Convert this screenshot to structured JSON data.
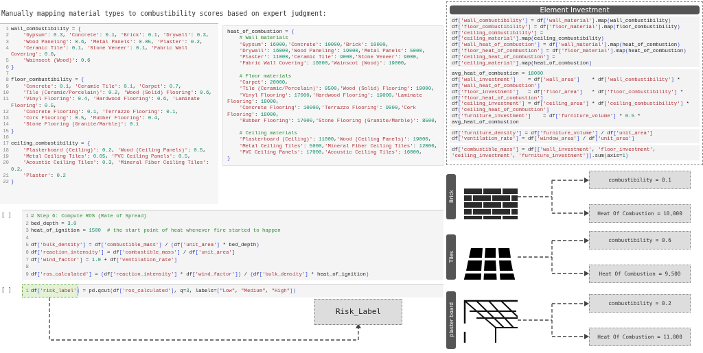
{
  "caption": "Manually mapping material types to combustibility scores based on expert judgment:",
  "numbered_code": {
    "lines": [
      {
        "number": "1",
        "text": "wall_combustibility = {"
      },
      {
        "number": "2",
        "text": "    'Gypsum': 0.3, 'Concrete': 0.1, 'Brick': 0.1, 'Drywall': 0.3,"
      },
      {
        "number": "3",
        "text": "    'Wood Paneling': 0.6, 'Metal Panels': 0.05, 'Plaster': 0.2,"
      },
      {
        "number": "4",
        "text": "    'Ceramic Tile': 0.1, 'Stone Veneer': 0.1, 'Fabric Wall Covering': 0.6,"
      },
      {
        "number": "5",
        "text": "    'Wainscot (Wood)': 0.6"
      },
      {
        "number": "6",
        "text": "}"
      },
      {
        "number": "7"
      },
      {
        "number": "8",
        "text": "floor_combustibility = {"
      },
      {
        "number": "9",
        "text": "    'Concrete': 0.1, 'Ceramic Tile': 0.1, 'Carpet': 0.7,"
      },
      {
        "number": "10",
        "text": "    'Tile (Ceramic/Porcelain)': 0.2, 'Wood (Solid) Flooring': 0.6,"
      },
      {
        "number": "11",
        "text": "    'Vinyl Flooring': 0.4, 'Hardwood Flooring': 0.6, 'Laminate Flooring': 0.5,"
      },
      {
        "number": "12",
        "text": "    'Concrete Flooring': 0.1, 'Terrazzo Flooring': 0.1,"
      },
      {
        "number": "13",
        "text": "    'Cork Flooring': 0.5, 'Rubber Flooring': 0.4,"
      },
      {
        "number": "14",
        "text": "    'Stone Flooring (Granite/Marble)': 0.1"
      },
      {
        "number": "15",
        "text": "}"
      },
      {
        "number": "16"
      },
      {
        "number": "17",
        "text": "ceiling_combustibility = {"
      },
      {
        "number": "18",
        "text": "    'Plasterboard (Ceiling)': 0.2, 'Wood (Ceiling Panels)': 0.5,"
      },
      {
        "number": "19",
        "text": "    'Metal Ceiling Tiles': 0.05, 'PVC Ceiling Panels': 0.5,"
      },
      {
        "number": "20",
        "text": "    'Acoustic Ceiling Tiles': 0.3, 'Mineral Fiber Ceiling Tiles': 0.2,"
      },
      {
        "number": "21",
        "text": "    'Plaster': 0.2"
      },
      {
        "number": "22",
        "text": "}"
      }
    ]
  },
  "heat_code": {
    "sections": [
      [
        "heat_of_combustion = {",
        "    # Wall materials",
        "    'Gypsum': 16000,'Concrete': 10000,'Brick': 10000,",
        "    'Drywall': 16000,'Wood Paneling': 19000,'Metal Panels': 5000,",
        "    'Plaster': 11000,'Ceramic Tile': 9000,'Stone Veneer': 9000,",
        "    'Fabric Wall Covering': 16000,'Wainscot (Wood)': 19000,"
      ],
      [
        "    # Floor materials",
        "    'Carpet': 20000,",
        "    'Tile (Ceramic/Porcelain)': 9500,'Wood (Solid) Flooring': 19000,",
        "    'Vinyl Flooring': 17000,'Hardwood Flooring': 19000,'Laminate Flooring': 18000,",
        "    'Concrete Flooring': 10000,'Terrazzo Flooring': 9000,'Cork Flooring': 18000,",
        "    'Rubber Flooring': 17000,'Stone Flooring (Granite/Marble)': 8500,"
      ],
      [
        "    # Ceiling materials",
        "    'Plasterboard (Ceiling)': 11000,'Wood (Ceiling Panels)': 19000,",
        "    'Metal Ceiling Tiles': 5000,'Mineral Fiber Ceiling Tiles': 12000,",
        "    'PVC Ceiling Panels': 17000,'Acoustic Ceiling Tiles': 16000,",
        "}"
      ]
    ]
  },
  "notebook_cells": [
    {
      "prompt": "[ ]",
      "highlighted": false,
      "lines": [
        {
          "number": "1",
          "text": "# Step 6: Compute ROS (Rate of Spread)"
        },
        {
          "number": "2",
          "text": "bed_depth = 3.0"
        },
        {
          "number": "3",
          "text": "heat_of_ignition = 1500  # the start point of heat whenever fire started to happen"
        },
        {
          "number": "4"
        },
        {
          "number": "5",
          "text": "df['bulk_density'] = df['combustible_mass'] / (df['unit_area'] * bed_depth)"
        },
        {
          "number": "6",
          "text": "df['reaction_intensity'] = df['combustible_mass'] / df['unit_area']"
        },
        {
          "number": "7",
          "text": "df['wind_factor'] = 1.0 + df['ventilation_rate']"
        },
        {
          "number": "8"
        },
        {
          "number": "9",
          "text": "df['ros_calculated'] = (df['reaction_intensity'] * df['wind_factor']) / (df['bulk_density'] * heat_of_ignition)"
        }
      ]
    },
    {
      "prompt": "[ ]",
      "highlighted": true,
      "lines": [
        {
          "number": "1",
          "text": "df['risk_label'] = pd.qcut(df['ros_calculated'], q=3, labels=[\"Low\", \"Medium\", \"High\"])"
        }
      ]
    }
  ],
  "output_box": "Risk_Label",
  "element_investment": {
    "title": "Element Investment",
    "blocks": [
      {
        "lines": [
          "df['wall_combustibility'] = df['wall_material'].map(wall_combustibility)",
          "df['floor_combustibility'] = df['floor_material'].map(floor_combustibility)",
          "df['ceiling_combustibility'] = df['ceiling_material'].map(ceiling_combustibility)",
          "df['wall_heat_of_combustion'] = df['wall_material'].map(heat_of_combustion)",
          "df['floor_heat_of_combustion'] = df['floor_material'].map(heat_of_combustion)",
          "df['ceiling_heat_of_combustion'] = df['ceiling_material'].map(heat_of_combustion)"
        ]
      },
      {
        "lines": [
          "avg_heat_of_combustion = 18000",
          "df['wall_investment']    = df['wall_area']    * df['wall_combustibility'] * df['wall_heat_of_combustion']",
          "df['floor_investment']   = df['floor_area']   * df['floor_combustibility'] * df['floor_heat_of_combustion']",
          "df['ceiling_investment'] = df['ceiling_area'] * df['ceiling_combustibility'] * df['ceiling_heat_of_combustion']",
          "df['furniture_investment']    = df['furniture_volume'] * 0.5 * avg_heat_of_combustion"
        ]
      },
      {
        "lines": [
          "df['furniture_density'] = df['furniture_volume'] / df['unit_area']",
          "df['ventilation_rate'] = df['window_area'] / df['unit_area']"
        ]
      },
      {
        "lines": [
          "df['combustible_mass'] = df[['wall_investment', 'floor_investment', 'ceiling_investment', 'furniture_investment']].sum(axis=1)"
        ]
      }
    ]
  },
  "materials": [
    {
      "label": "Brick",
      "kind": "brick",
      "boxes": [
        "combustibility = 0.1",
        "Heat Of Combustion = 10,000"
      ]
    },
    {
      "label": "Tiles",
      "kind": "tiles",
      "boxes": [
        "combustibility = 0.6",
        "Heat Of Combustion = 9,500"
      ]
    },
    {
      "label": "plaster board",
      "kind": "ceiling",
      "boxes": [
        "combustibility = 0.2",
        "Heat Of Combustion = 11,000"
      ]
    }
  ]
}
